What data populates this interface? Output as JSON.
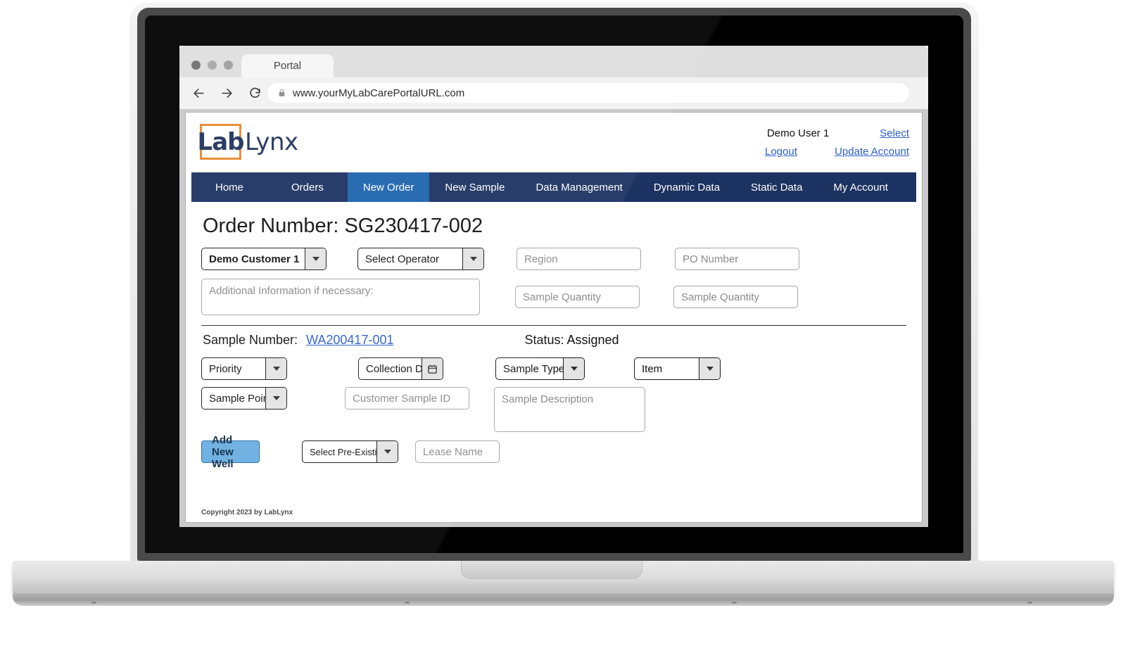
{
  "browser": {
    "tab_label": "Portal",
    "url": "www.yourMyLabCarePortalURL.com",
    "back_icon": "back-arrow-icon",
    "forward_icon": "forward-arrow-icon",
    "reload_icon": "reload-icon",
    "lock_icon": "lock-icon"
  },
  "app": {
    "logo_mark": "Lab",
    "logo_word": "Lynx",
    "logo_border_color": "#e8892d",
    "brand_color": "#21335c",
    "nav_active_color": "#1e63ad"
  },
  "account": {
    "user_name": "Demo User 1",
    "select_link": "Select",
    "logout_link": "Logout",
    "update_account_link": "Update Account"
  },
  "nav": {
    "items": [
      {
        "label": "Home",
        "active": false
      },
      {
        "label": "Orders",
        "active": false
      },
      {
        "label": "New Order",
        "active": true
      },
      {
        "label": "New Sample",
        "active": false
      },
      {
        "label": "Data Management",
        "active": false
      },
      {
        "label": "Dynamic Data",
        "active": false
      },
      {
        "label": "Static Data",
        "active": false
      },
      {
        "label": "My Account",
        "active": false
      }
    ]
  },
  "order": {
    "title": "Order Number: SG230417-002",
    "customer_select": "Demo Customer 1",
    "operator_select": "Select Operator",
    "region_placeholder": "Region",
    "po_number_placeholder": "PO Number",
    "additional_info_placeholder": "Additional Information if necessary:",
    "sample_quantity_1_placeholder": "Sample Quantity",
    "sample_quantity_2_placeholder": "Sample Quantity"
  },
  "sample": {
    "number_label": "Sample Number:",
    "number_value": "WA200417-001",
    "status": "Status: Assigned",
    "priority_select": "Priority",
    "collection_date": "Collection Date",
    "calendar_icon": "calendar-icon",
    "sample_type_select": "Sample Type",
    "item_select": "Item",
    "sample_point_select": "Sample Point",
    "customer_sample_id_placeholder": "Customer Sample ID",
    "sample_description_placeholder": "Sample Description",
    "add_new_well_button": "Add New Well",
    "pre_existing_well_select": "Select Pre-Existing Well",
    "lease_name_placeholder": "Lease Name"
  },
  "footer": {
    "copyright": "Copyright 2023 by LabLynx"
  }
}
